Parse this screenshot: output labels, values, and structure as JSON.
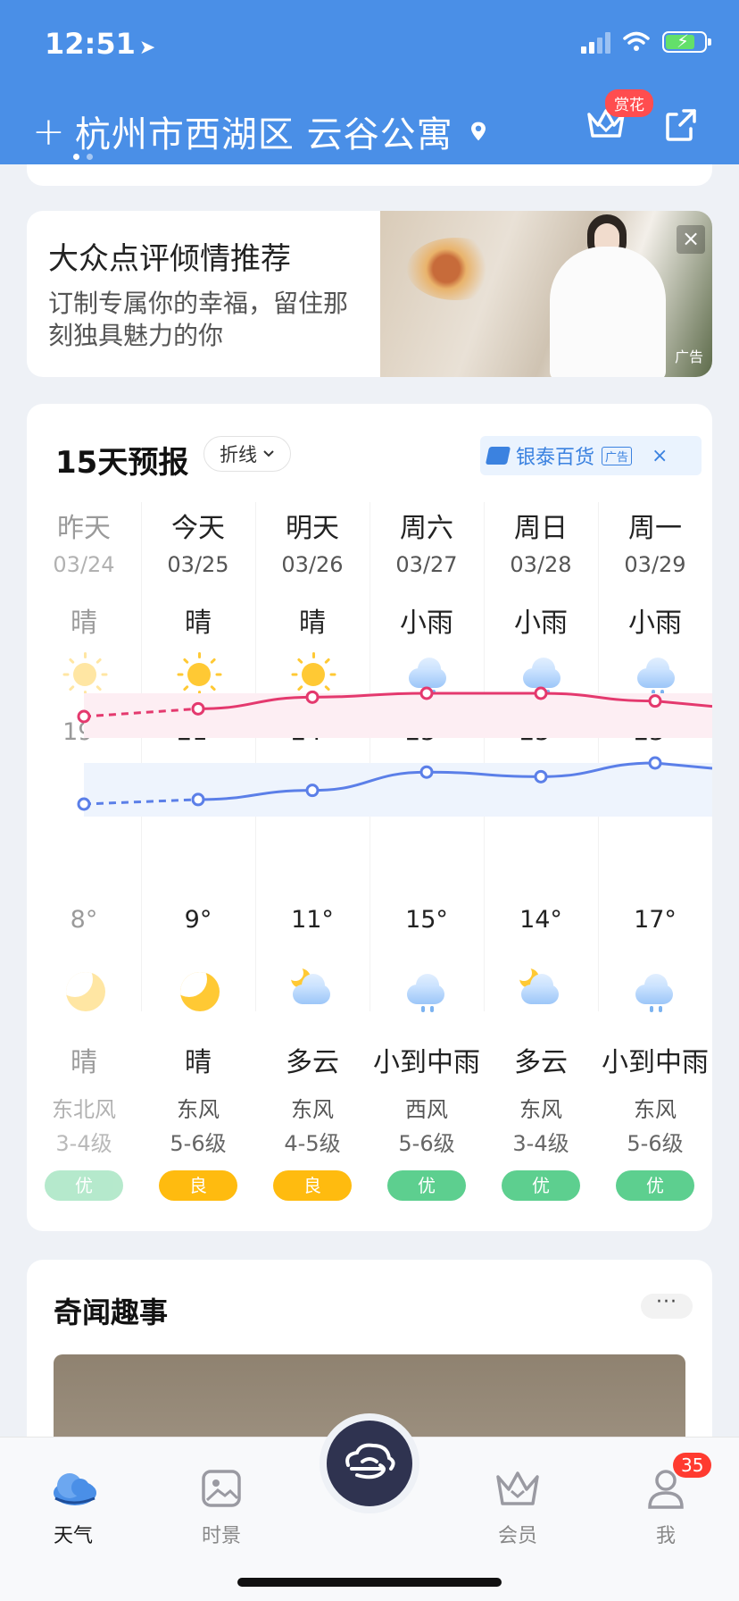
{
  "status_bar": {
    "time": "12:51"
  },
  "header": {
    "add_symbol": "+",
    "location": "杭州市西湖区 云谷公寓",
    "reward_badge": "赏花"
  },
  "ad_card": {
    "title": "大众点评倾情推荐",
    "description": "订制专属你的幸福，留住那刻独具魅力的你",
    "tag": "广告",
    "close": "×"
  },
  "forecast": {
    "title": "15天预报",
    "mode": "折线",
    "sponsor": {
      "name": "银泰百货",
      "tag": "广告",
      "close": "×"
    },
    "days": [
      {
        "name": "昨天",
        "date": "03/24",
        "day_cond": "晴",
        "day_icon": "sun-icon",
        "high": "19°",
        "low": "8°",
        "night_icon": "moon-icon",
        "night_cond": "晴",
        "wind": "东北风",
        "level": "3-4级",
        "aqi": "优",
        "aqi_color": "#5dcf8f"
      },
      {
        "name": "今天",
        "date": "03/25",
        "day_cond": "晴",
        "day_icon": "sun-icon",
        "high": "21°",
        "low": "9°",
        "night_icon": "moon-icon",
        "night_cond": "晴",
        "wind": "东风",
        "level": "5-6级",
        "aqi": "良",
        "aqi_color": "#ffbb0f"
      },
      {
        "name": "明天",
        "date": "03/26",
        "day_cond": "晴",
        "day_icon": "sun-icon",
        "high": "24°",
        "low": "11°",
        "night_icon": "moon-cloud-icon",
        "night_cond": "多云",
        "wind": "东风",
        "level": "4-5级",
        "aqi": "良",
        "aqi_color": "#ffbb0f"
      },
      {
        "name": "周六",
        "date": "03/27",
        "day_cond": "小雨",
        "day_icon": "rain-cloud-icon",
        "high": "25°",
        "low": "15°",
        "night_icon": "rain-cloud-icon",
        "night_cond": "小到中雨",
        "wind": "西风",
        "level": "5-6级",
        "aqi": "优",
        "aqi_color": "#5dcf8f"
      },
      {
        "name": "周日",
        "date": "03/28",
        "day_cond": "小雨",
        "day_icon": "rain-cloud-icon",
        "high": "25°",
        "low": "14°",
        "night_icon": "moon-cloud-icon",
        "night_cond": "多云",
        "wind": "东风",
        "level": "3-4级",
        "aqi": "优",
        "aqi_color": "#5dcf8f"
      },
      {
        "name": "周一",
        "date": "03/29",
        "day_cond": "小雨",
        "day_icon": "rain-cloud-icon",
        "high": "23°",
        "low": "17°",
        "night_icon": "rain-cloud-icon",
        "night_cond": "小到中雨",
        "wind": "东风",
        "level": "5-6级",
        "aqi": "优",
        "aqi_color": "#5dcf8f"
      }
    ],
    "high_line_color": "#e4396e",
    "low_line_color": "#5b7fe8"
  },
  "news": {
    "title": "奇闻趣事",
    "more": "···"
  },
  "tabbar": {
    "weather": "天气",
    "scenery": "时景",
    "member": "会员",
    "me": "我",
    "me_badge": "35"
  }
}
